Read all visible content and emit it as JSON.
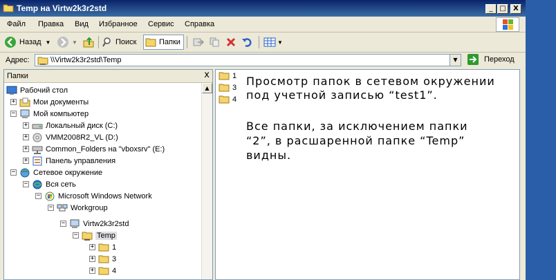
{
  "window": {
    "title": "Temp на Virtw2k3r2std",
    "minimize": "_",
    "maximize": "□",
    "close": "X"
  },
  "menu": {
    "items": [
      "Файл",
      "Правка",
      "Вид",
      "Избранное",
      "Сервис",
      "Справка"
    ]
  },
  "toolbar": {
    "back": "Назад",
    "search": "Поиск",
    "folders": "Папки"
  },
  "address": {
    "label": "Адрес:",
    "value": "\\\\Virtw2k3r2std\\Temp",
    "go": "Переход"
  },
  "tree": {
    "header": "Папки",
    "close": "x",
    "items": [
      {
        "label": "Рабочий стол"
      },
      {
        "label": "Мои документы"
      },
      {
        "label": "Мой компьютер"
      },
      {
        "label": "Локальный диск (C:)"
      },
      {
        "label": "VMM2008R2_VL (D:)"
      },
      {
        "label": "Common_Folders на \"vboxsrv\" (E:)"
      },
      {
        "label": "Панель управления"
      },
      {
        "label": "Сетевое окружение"
      },
      {
        "label": "Вся сеть"
      },
      {
        "label": "Microsoft Windows Network"
      },
      {
        "label": "Workgroup"
      },
      {
        "label": "Virtw2k3r2std"
      },
      {
        "label": "Temp"
      },
      {
        "label": "1"
      },
      {
        "label": "3"
      },
      {
        "label": "4"
      }
    ]
  },
  "content": {
    "files": [
      {
        "name": "1"
      },
      {
        "name": "3"
      },
      {
        "name": "4"
      }
    ],
    "note_lines": [
      "Просмотр папок в сетевом окружении",
      "под учетной записью “test1”.",
      "Все папки, за исключением папки",
      "“2”, в расшаренной папке “Temp”",
      "видны."
    ]
  },
  "colors": {
    "title_bar": "#0a246a",
    "window_bg": "#ece9d8",
    "folder": "#f5d56b",
    "go_arrow": "#2e9a2e"
  }
}
